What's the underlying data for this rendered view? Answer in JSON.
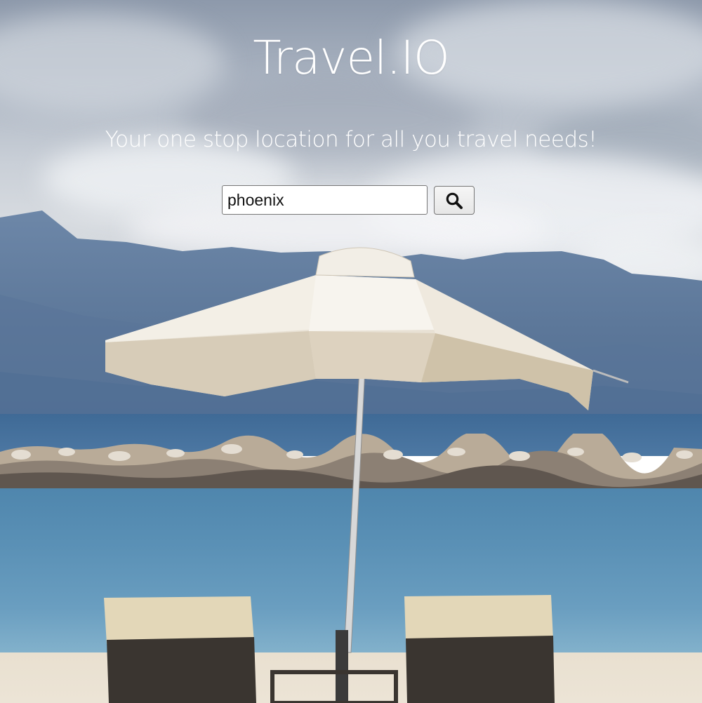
{
  "header": {
    "title": "Travel.IO",
    "tagline": "Your one stop location for all you travel needs!"
  },
  "search": {
    "value": "phoenix",
    "button_icon": "search-icon"
  },
  "background": {
    "image": "beach-umbrella-photo"
  },
  "colors": {
    "heading_text": "#ffffff",
    "input_border": "#767676",
    "button_bg": "#eeeeee"
  }
}
